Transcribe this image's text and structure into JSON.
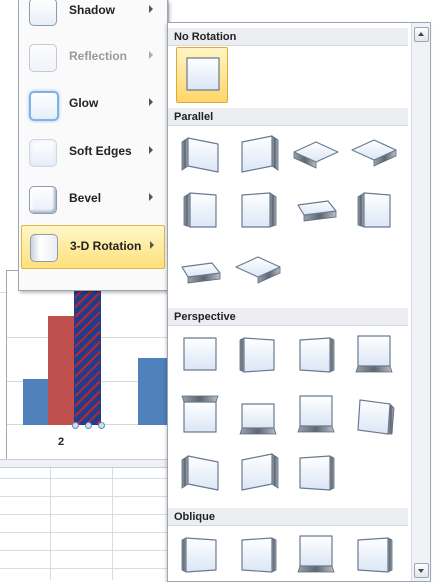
{
  "menu": {
    "items": [
      {
        "label": "Shadow",
        "name": "shadow",
        "enabled": true
      },
      {
        "label": "Reflection",
        "name": "reflection",
        "enabled": false
      },
      {
        "label": "Glow",
        "name": "glow",
        "enabled": true
      },
      {
        "label": "Soft Edges",
        "name": "soft-edges",
        "enabled": true
      },
      {
        "label": "Bevel",
        "name": "bevel",
        "enabled": true
      },
      {
        "label": "3-D Rotation",
        "name": "3d-rotation",
        "enabled": true,
        "active": true
      }
    ]
  },
  "gallery": {
    "sections": [
      {
        "title": "No Rotation",
        "presets": [
          "No Rotation"
        ]
      },
      {
        "title": "Parallel",
        "presets": [
          "Isometric Left Down",
          "Isometric Right Up",
          "Isometric Top Up",
          "Isometric Top Down",
          "Off Axis 1 Left",
          "Off Axis 1 Right",
          "Off Axis 1 Top",
          "Off Axis 2 Left",
          "Off Axis 2 Right",
          "Off Axis 2 Top"
        ]
      },
      {
        "title": "Perspective",
        "presets": [
          "Perspective Front",
          "Perspective Left",
          "Perspective Right",
          "Perspective Below",
          "Perspective Above",
          "Perspective Contrasting Left",
          "Perspective Heroic Extreme Left",
          "Perspective Heroic Extreme Right",
          "Perspective Relaxed",
          "Perspective Relaxed Moderately",
          "Perspective Left 2"
        ]
      },
      {
        "title": "Oblique",
        "presets": [
          "Oblique Top Left",
          "Oblique Top Right",
          "Oblique Bottom Left",
          "Oblique Bottom Right"
        ]
      }
    ]
  },
  "chart": {
    "category_label": "2",
    "colors": {
      "blue": "#4f81bd",
      "red": "#c0504d",
      "hatch": "#1f3d8c"
    }
  },
  "colors": {
    "accent": "#ffe07a",
    "selection_border": "#e0a83a"
  }
}
